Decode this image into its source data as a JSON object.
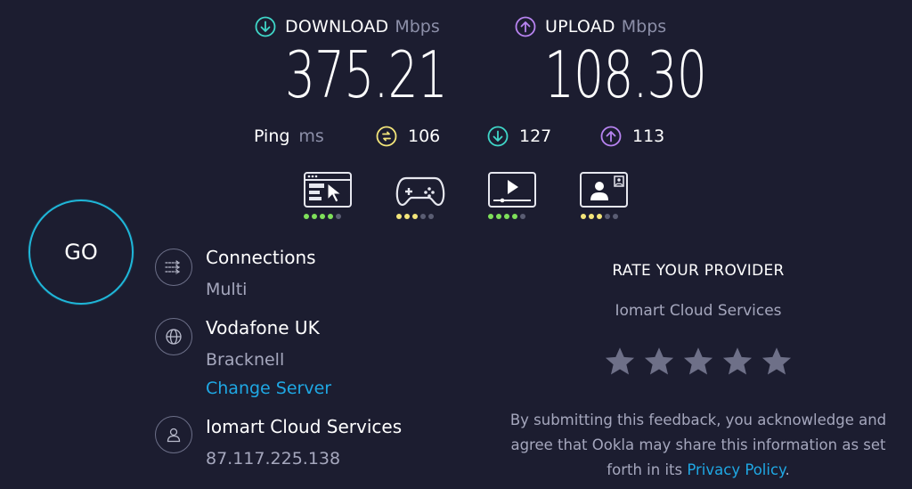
{
  "download": {
    "label": "DOWNLOAD",
    "unit": "Mbps",
    "value": "375.21",
    "color": "#3fd6c8"
  },
  "upload": {
    "label": "UPLOAD",
    "unit": "Mbps",
    "value": "108.30",
    "color": "#b783f0"
  },
  "ping": {
    "label": "Ping",
    "unit": "ms",
    "idle": {
      "value": "106",
      "icon": "ping-idle-icon",
      "color": "#f3e57a"
    },
    "download": {
      "value": "127",
      "icon": "download-arrow-icon",
      "color": "#3fd6c8"
    },
    "upload": {
      "value": "113",
      "icon": "upload-arrow-icon",
      "color": "#b783f0"
    }
  },
  "activities": [
    {
      "icon": "web-browsing-icon",
      "rating": 4,
      "of": 5,
      "color": "#7ee05a"
    },
    {
      "icon": "gaming-icon",
      "rating": 3,
      "of": 5,
      "color": "#f3e57a"
    },
    {
      "icon": "video-streaming-icon",
      "rating": 4,
      "of": 5,
      "color": "#7ee05a"
    },
    {
      "icon": "video-chat-icon",
      "rating": 3,
      "of": 5,
      "color": "#f3e57a"
    }
  ],
  "go_label": "GO",
  "connections": {
    "title": "Connections",
    "value": "Multi"
  },
  "server": {
    "title": "Vodafone UK",
    "location": "Bracknell",
    "change_label": "Change Server"
  },
  "provider": {
    "title": "Iomart Cloud Services",
    "ip": "87.117.225.138"
  },
  "rate": {
    "title": "RATE YOUR PROVIDER",
    "provider": "Iomart Cloud Services",
    "stars": 5,
    "note_line1": "By submitting this feedback, you acknowledge and",
    "note_line2": "agree that Ookla may share this information as set",
    "note_line3_prefix": "forth in its",
    "privacy_link": "Privacy Policy",
    "note_line3_suffix": "."
  }
}
